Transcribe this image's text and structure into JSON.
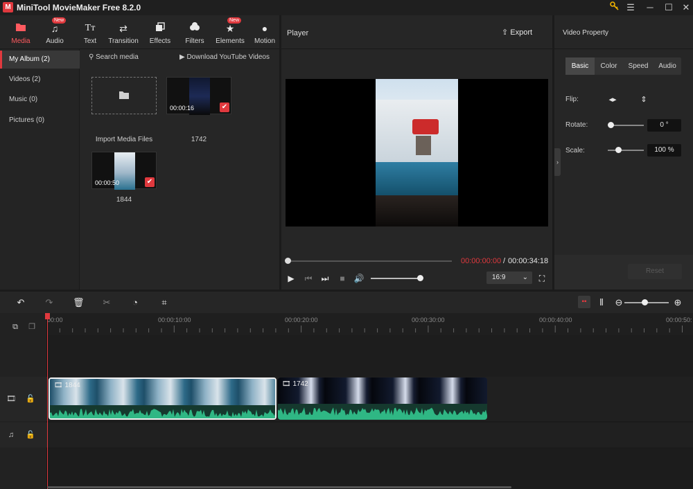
{
  "app": {
    "title": "MiniTool MovieMaker Free 8.2.0",
    "logo_letter": "M"
  },
  "toolbar": {
    "items": [
      {
        "label": "Media",
        "icon": "folder-icon"
      },
      {
        "label": "Audio",
        "icon": "music-icon",
        "badge": "New"
      },
      {
        "label": "Text",
        "icon": "text-icon"
      },
      {
        "label": "Transition",
        "icon": "transition-icon"
      },
      {
        "label": "Effects",
        "icon": "effects-icon"
      },
      {
        "label": "Filters",
        "icon": "filters-icon"
      },
      {
        "label": "Elements",
        "icon": "elements-icon",
        "badge": "New"
      },
      {
        "label": "Motion",
        "icon": "motion-icon"
      }
    ]
  },
  "sidebar": {
    "items": [
      {
        "label": "My Album (2)"
      },
      {
        "label": "Videos (2)"
      },
      {
        "label": "Music (0)"
      },
      {
        "label": "Pictures (0)"
      }
    ]
  },
  "media": {
    "search_label": "Search media",
    "youtube_label": "Download YouTube Videos",
    "import_label": "Import Media Files",
    "items": [
      {
        "name": "1742",
        "duration": "00:00:16"
      },
      {
        "name": "1844",
        "duration": "00:00:50"
      }
    ]
  },
  "player": {
    "title": "Player",
    "export_label": "Export",
    "time_current": "00:00:00:00",
    "time_separator": "/",
    "time_total": "00:00:34:18",
    "aspect_ratio": "16:9",
    "progress": 0,
    "volume": 1.0
  },
  "properties": {
    "title": "Video Property",
    "tabs": [
      "Basic",
      "Color",
      "Speed",
      "Audio"
    ],
    "flip_label": "Flip:",
    "rotate_label": "Rotate:",
    "rotate_value": "0 °",
    "scale_label": "Scale:",
    "scale_value": "100 %",
    "reset_label": "Reset"
  },
  "timeline": {
    "ruler": [
      "00:00",
      "00:00:10:00",
      "00:00:20:00",
      "00:00:30:00",
      "00:00:40:00",
      "00:00:50:"
    ],
    "clips": [
      {
        "name": "1844"
      },
      {
        "name": "1742"
      }
    ]
  },
  "colors": {
    "accent": "#e0393e",
    "audio_wave": "#2fb784",
    "background": "#1b1b1b",
    "panel": "#262626"
  }
}
